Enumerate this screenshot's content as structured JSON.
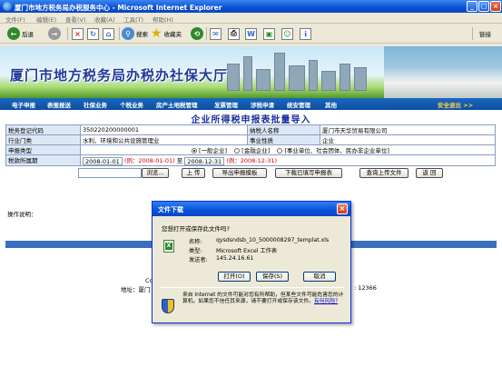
{
  "window": {
    "title": "厦门市地方税务局办税服务中心 - Microsoft Internet Explorer"
  },
  "menubar": {
    "items": [
      "文件(F)",
      "编辑(E)",
      "查看(V)",
      "收藏(A)",
      "工具(T)",
      "帮助(H)"
    ]
  },
  "toolbar": {
    "back": "后退",
    "search": "搜索",
    "favorites": "收藏夹",
    "links": "链接"
  },
  "banner": {
    "title": "厦门市地方税务局办税办社保大厅"
  },
  "nav": {
    "items": [
      "电子申报",
      "表报报送",
      "社保业务",
      "个税业务",
      "房产土地税管理",
      "发票管理",
      "涉税申请",
      "统安管理",
      "其他"
    ],
    "safe_exit": "安全退出 >>"
  },
  "page": {
    "title": "企业所得税申报表批量导入"
  },
  "form": {
    "tax_reg_label": "税务登记代码",
    "tax_reg_value": "350220200000001",
    "taxpayer_label": "纳税人名称",
    "taxpayer_value": "厦门市天华贸易有限公司",
    "industry_label": "行业门类",
    "industry_value": "水利、环境和公共设施管理业",
    "collection_label": "事业性质",
    "collection_value": "企业",
    "decl_type_label": "申报类型",
    "decl_options": [
      "[一般企业]",
      "[金融企业]",
      "[事业单位、社会团体、民办非企业单位]"
    ],
    "period_label": "税款所属期",
    "period_start": "2008-01-01",
    "period_start_hint": "(例：2008-01-01)",
    "period_to": "至",
    "period_end": "2008-12-31",
    "period_end_hint": "(例：2008-12-31)"
  },
  "buttons": {
    "browse": "浏览...",
    "upload": "上 传",
    "export_template": "导出申报模板",
    "export_filled": "下载已填写申报表",
    "query_upload": "查询上传文件",
    "back": "返 回"
  },
  "operation": {
    "label": "操作说明："
  },
  "footer": {
    "copyright": "Cop",
    "address": "地址：厦门",
    "phone": ": 12366"
  },
  "dialog": {
    "title": "文件下载",
    "question": "您想打开或保存此文件吗?",
    "name_label": "名称:",
    "name_value": "qysdsndsb_10_5000008297_templat.xls",
    "type_label": "类型:",
    "type_value": "Microsoft Excel 工作表",
    "sender_label": "发送者:",
    "sender_value": "145.24.16.61",
    "open": "打开(O)",
    "save": "保存(S)",
    "cancel": "取消",
    "warning": "来自 Internet 的文件可能对您有所帮助，但某些文件可能危害您的计算机。如果您不信任其来源，请不要打开或保存该文件。",
    "risk_link": "有何风险?"
  },
  "colors": {
    "title_blue": "#0a4fd6",
    "nav_blue": "#0c4ea0",
    "page_title": "#1a2fa0",
    "hint_red": "#d40000"
  }
}
